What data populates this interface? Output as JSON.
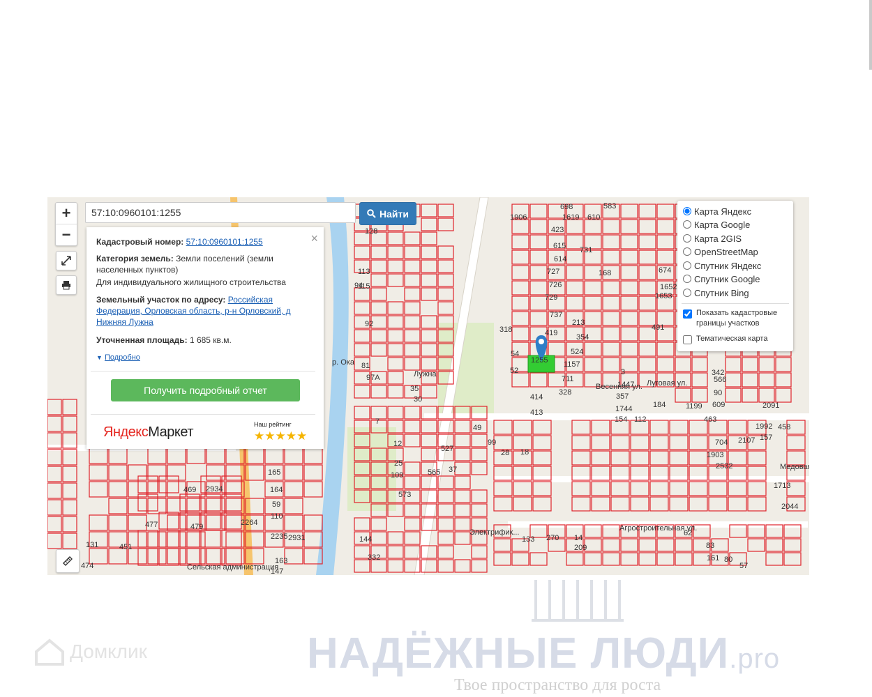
{
  "search": {
    "value": "57:10:0960101:1255",
    "button_label": "Найти"
  },
  "zoom": {
    "in_label": "+",
    "out_label": "−"
  },
  "info_card": {
    "cad_label": "Кадастровый номер:",
    "cad_value": "57:10:0960101:1255",
    "category_label": "Категория земель:",
    "category_value": "Земли поселений (земли населенных пунктов)",
    "usage": "Для индивидуального жилищного строительства",
    "address_label": "Земельный участок по адресу:",
    "address_value": "Российская Федерация, Орловская область, р-н Орловский, д Нижняя Лужна",
    "area_label": "Уточненная площадь:",
    "area_value": "1 685 кв.м.",
    "more_label": "Подробно",
    "report_button": "Получить подробный отчет",
    "market_logo_a": "Яндекс",
    "market_logo_b": "Маркет",
    "rating_label": "Наш рейтинг",
    "stars": "★★★★★",
    "close": "×"
  },
  "layers": {
    "options": [
      "Карта Яндекс",
      "Карта Google",
      "Карта 2GIS",
      "OpenStreetMap",
      "Спутник Яндекс",
      "Спутник Google",
      "Спутник Bing"
    ],
    "selected": "Карта Яндекс",
    "show_borders": "Показать кадастровые границы участков",
    "thematic": "Тематическая карта"
  },
  "map_labels": [
    "1906",
    "423",
    "615",
    "614",
    "727",
    "726",
    "729",
    "737",
    "419",
    "318",
    "54",
    "52",
    "1255",
    "213",
    "354",
    "524",
    "1157",
    "711",
    "328",
    "414",
    "413",
    "3",
    "1447",
    "357",
    "1744",
    "154",
    "112",
    "184",
    "1199",
    "463",
    "609",
    "90",
    "566",
    "342",
    "704",
    "2107",
    "157",
    "1903",
    "2532",
    "128",
    "113",
    "115",
    "94",
    "92",
    "81",
    "35",
    "30",
    "97А",
    "7",
    "12",
    "25",
    "109",
    "165",
    "164",
    "59",
    "110",
    "2235",
    "2931",
    "163",
    "147",
    "131",
    "474",
    "451",
    "477",
    "479",
    "2934",
    "469",
    "573",
    "133",
    "270",
    "14",
    "209",
    "144",
    "332",
    "49",
    "99",
    "28",
    "18",
    "527",
    "565",
    "37",
    "698",
    "1619",
    "610",
    "583",
    "731",
    "168",
    "674",
    "1652",
    "1653",
    "491",
    "1992",
    "2091",
    "458",
    "2044",
    "1713",
    "2264",
    "62",
    "83",
    "161",
    "80",
    "57",
    "Лужна",
    "р. Ока",
    "Весенняя ул.",
    "Луговая ул.",
    "Медовая ул.",
    "Агростроительная ул.",
    "Сельская администрация",
    "Электрифик..."
  ],
  "watermarks": {
    "domclick": "Домклик",
    "brand_main": "НАДЁЖНЫЕ ЛЮДИ",
    "brand_tld": ".pro",
    "brand_sub": "Твое пространство для роста"
  },
  "colors": {
    "parcel_border": "#e0232b",
    "selected_parcel": "#33cc33",
    "marker": "#2e7ec7",
    "river": "#a9d3f0",
    "road": "#f6c46c",
    "search_button": "#337ab7",
    "report_button": "#5cb85c"
  }
}
